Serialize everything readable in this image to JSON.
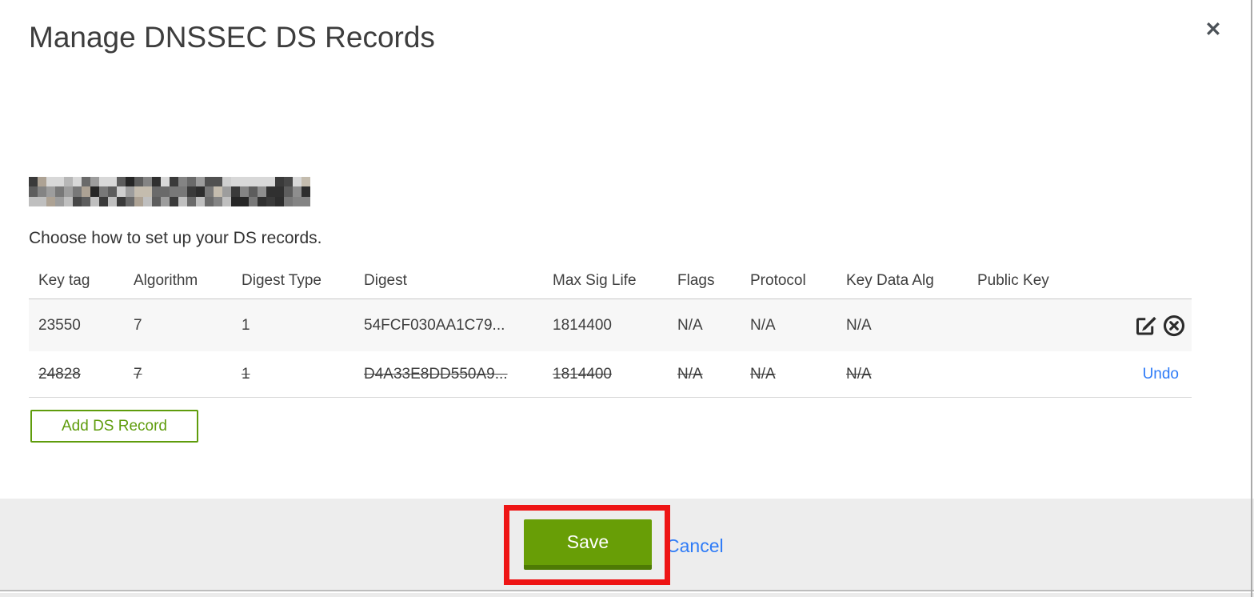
{
  "dialog": {
    "title": "Manage DNSSEC DS Records",
    "subtitle": "Choose how to set up your DS records.",
    "close_glyph": "✕",
    "domain_redacted": true
  },
  "table": {
    "columns": [
      "Key tag",
      "Algorithm",
      "Digest Type",
      "Digest",
      "Max Sig Life",
      "Flags",
      "Protocol",
      "Key Data Alg",
      "Public Key"
    ],
    "rows": [
      {
        "key_tag": "23550",
        "algorithm": "7",
        "digest_type": "1",
        "digest": "54FCF030AA1C79...",
        "max_sig_life": "1814400",
        "flags": "N/A",
        "protocol": "N/A",
        "key_data_alg": "N/A",
        "public_key": "",
        "state": "normal",
        "actions": [
          "edit",
          "delete"
        ]
      },
      {
        "key_tag": "24828",
        "algorithm": "7",
        "digest_type": "1",
        "digest": "D4A33E8DD550A9...",
        "max_sig_life": "1814400",
        "flags": "N/A",
        "protocol": "N/A",
        "key_data_alg": "N/A",
        "public_key": "",
        "state": "deleted",
        "action_label": "Undo"
      }
    ]
  },
  "buttons": {
    "add_ds_record": "Add DS Record",
    "save": "Save",
    "cancel": "Cancel"
  },
  "icons": {
    "close": "x-mark",
    "edit": "pencil-in-square",
    "delete": "x-in-circle"
  },
  "colors": {
    "accent_green": "#689e06",
    "accent_green_dark": "#4e7a04",
    "outline_green": "#5f9c0c",
    "link_blue": "#2e7bf7",
    "footer_gray": "#ededed",
    "row_stripe_gray": "#f7f7f7",
    "annotation_red": "#ee1515",
    "text_dark": "#3e3e3e"
  }
}
